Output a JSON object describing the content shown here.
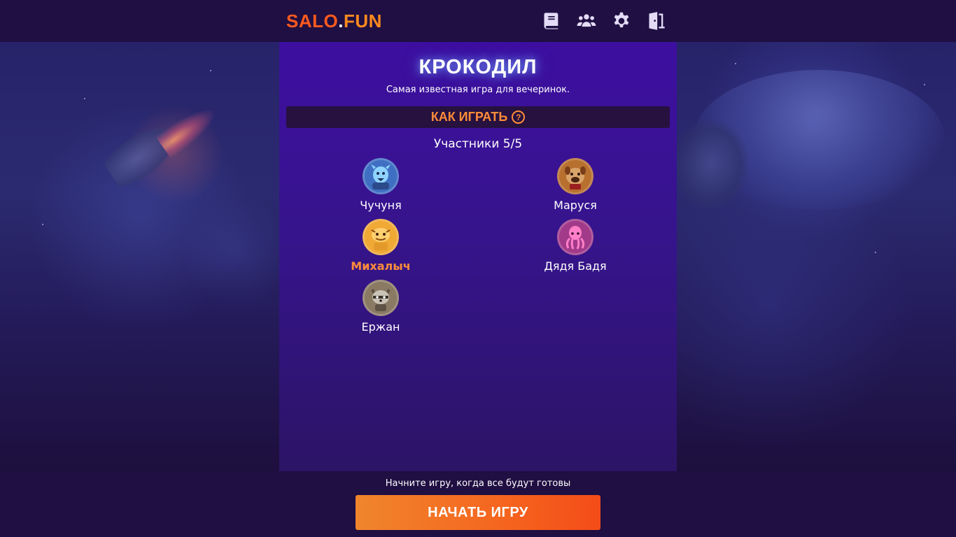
{
  "header": {
    "logo_part1": "SALO",
    "logo_dot": ".",
    "logo_part2": "FUN",
    "icons": [
      "book-icon",
      "users-icon",
      "gear-icon",
      "exit-door-icon"
    ]
  },
  "game": {
    "title": "КРОКОДИЛ",
    "subtitle": "Самая известная игра для вечеринок.",
    "how_to_play": "КАК ИГРАТЬ",
    "help_symbol": "?",
    "participants_label": "Участники 5/5"
  },
  "players": [
    {
      "name": "Чучуня",
      "avatar": "blue-creature-avatar",
      "color": "#3f6fc2",
      "me": false
    },
    {
      "name": "Маруся",
      "avatar": "bulldog-avatar",
      "color": "#b8702f",
      "me": false
    },
    {
      "name": "Михалыч",
      "avatar": "lizard-avatar",
      "color": "#f0a935",
      "me": true
    },
    {
      "name": "Дядя Бадя",
      "avatar": "octopus-avatar",
      "color": "#a23a8a",
      "me": false
    },
    {
      "name": "Ержан",
      "avatar": "raccoon-avatar",
      "color": "#8a7a64",
      "me": false
    }
  ],
  "footer": {
    "hint": "Начните игру, когда все будут готовы",
    "start_button": "НАЧАТЬ ИГРУ"
  },
  "colors": {
    "accent_orange": "#ff8c3a",
    "logo_red": "#ff5a1e",
    "panel_purple": "#3d0fa0",
    "header_bg": "#1f0f42"
  }
}
